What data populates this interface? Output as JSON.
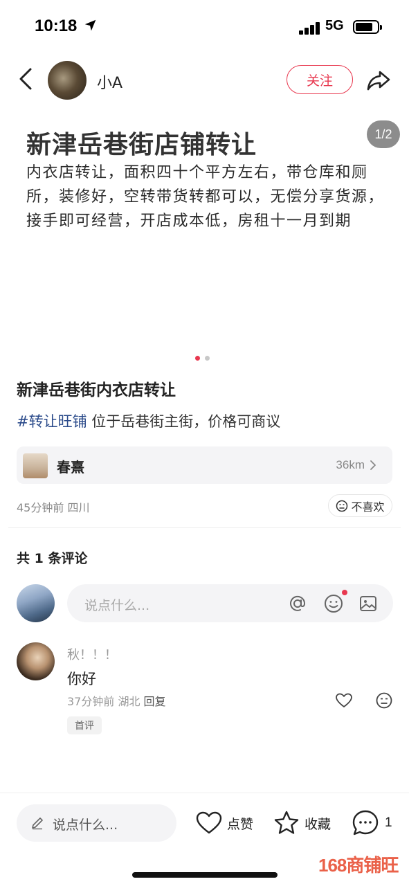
{
  "status_bar": {
    "time": "10:18",
    "network": "5G"
  },
  "header": {
    "author_name": "小A",
    "follow_label": "关注"
  },
  "card": {
    "page_counter": "1/2",
    "title": "新津岳巷街店铺转让",
    "body": "内衣店转让，面积四十个平方左右，带仓库和厕所，装修好，空转带货转都可以，无偿分享货源，接手即可经营，开店成本低，房租十一月到期"
  },
  "post": {
    "title": "新津岳巷街内衣店转让",
    "hashtag": "#转让旺铺",
    "description": " 位于岳巷街主街，价格可商议",
    "location": {
      "name": "春熹",
      "distance": "36km"
    },
    "meta": "45分钟前 四川",
    "dislike_label": "不喜欢"
  },
  "comments": {
    "count_label": "共 1 条评论",
    "input_placeholder": "说点什么...",
    "items": [
      {
        "name": "秋！！！",
        "text": "你好",
        "meta": "37分钟前 湖北",
        "reply_label": "回复",
        "badge": "首评"
      }
    ]
  },
  "bottom_bar": {
    "input_placeholder": "说点什么...",
    "like_label": "点赞",
    "collect_label": "收藏",
    "comment_count": "1"
  },
  "watermark": "168商铺旺",
  "colors": {
    "accent": "#e8384f",
    "hashtag": "#2a4a8a",
    "watermark": "#e9543a"
  }
}
